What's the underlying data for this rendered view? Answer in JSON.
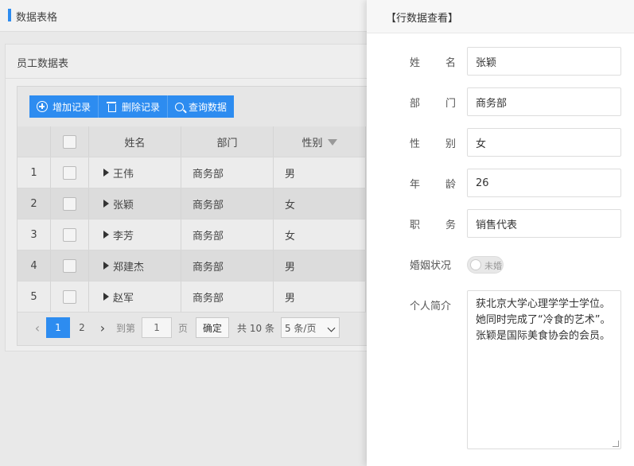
{
  "header": {
    "title": "数据表格"
  },
  "card": {
    "title": "员工数据表"
  },
  "toolbar": {
    "add": "增加记录",
    "delete": "删除记录",
    "query": "查询数据"
  },
  "table": {
    "columns": {
      "name": "姓名",
      "dept": "部门",
      "sex": "性别"
    },
    "rows": [
      {
        "idx": "1",
        "name": "王伟",
        "dept": "商务部",
        "sex": "男"
      },
      {
        "idx": "2",
        "name": "张颖",
        "dept": "商务部",
        "sex": "女"
      },
      {
        "idx": "3",
        "name": "李芳",
        "dept": "商务部",
        "sex": "女"
      },
      {
        "idx": "4",
        "name": "郑建杰",
        "dept": "商务部",
        "sex": "男"
      },
      {
        "idx": "5",
        "name": "赵军",
        "dept": "商务部",
        "sex": "男"
      }
    ]
  },
  "pager": {
    "prev": "‹",
    "next": "›",
    "page1": "1",
    "page2": "2",
    "goto_label": "到第",
    "goto_value": "1",
    "page_unit": "页",
    "confirm": "确定",
    "total": "共 10 条",
    "page_size": "5 条/页"
  },
  "panel": {
    "title": "【行数据查看】",
    "fields": {
      "name": {
        "label_a": "姓",
        "label_b": "名",
        "value": "张颖"
      },
      "dept": {
        "label_a": "部",
        "label_b": "门",
        "value": "商务部"
      },
      "sex": {
        "label_a": "性",
        "label_b": "别",
        "value": "女"
      },
      "age": {
        "label_a": "年",
        "label_b": "龄",
        "value": "26"
      },
      "title": {
        "label_a": "职",
        "label_b": "务",
        "value": "销售代表"
      },
      "married": {
        "label": "婚姻状况",
        "value": "未婚"
      },
      "bio": {
        "label": "个人简介",
        "value": "获北京大学心理学学士学位。她同时完成了“冷食的艺术”。张颖是国际美食协会的会员。"
      }
    }
  }
}
